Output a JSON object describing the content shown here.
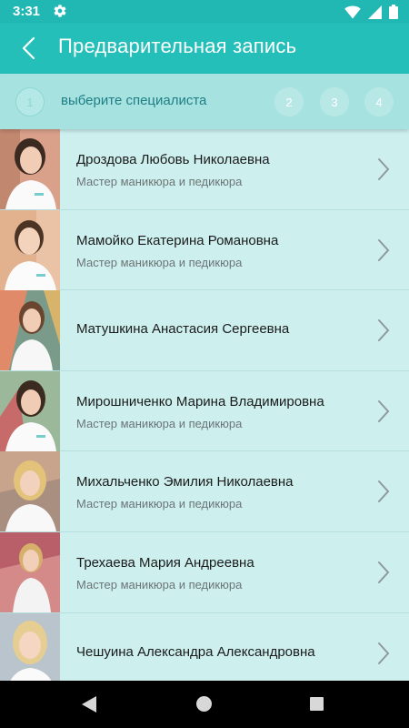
{
  "status_bar": {
    "time": "3:31",
    "icons": [
      "gear-icon",
      "wifi-icon",
      "signal-icon",
      "battery-icon"
    ]
  },
  "header": {
    "title": "Предварительная запись",
    "back_icon": "chevron-left-icon"
  },
  "steps": {
    "current_number": "1",
    "current_label": "выберите специалиста",
    "others": [
      "2",
      "3",
      "4"
    ]
  },
  "specialists": [
    {
      "name": "Дроздова Любовь Николаевна",
      "role": "Мастер маникюра и педикюра"
    },
    {
      "name": "Мамойко Екатерина Романовна",
      "role": "Мастер маникюра и педикюра"
    },
    {
      "name": "Матушкина Анастасия Сергеевна",
      "role": ""
    },
    {
      "name": "Мирошниченко Марина Владимировна",
      "role": "Мастер маникюра и педикюра"
    },
    {
      "name": "Михальченко Эмилия Николаевна",
      "role": "Мастер маникюра и педикюра"
    },
    {
      "name": "Трехаева Мария Андреевна",
      "role": "Мастер маникюра и педикюра"
    },
    {
      "name": "Чешуина Александра Александровна",
      "role": ""
    }
  ],
  "colors": {
    "primary": "#25bfba",
    "status_bar": "#21b8b4",
    "steps_bg": "#a5e2e0",
    "list_bg": "#cdf0ef",
    "step_text": "#1f7f85"
  }
}
